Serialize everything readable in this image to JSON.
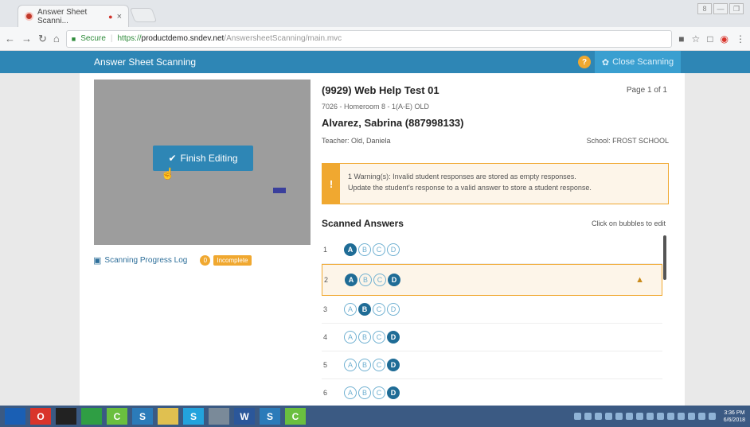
{
  "browser": {
    "tab_title": "Answer Sheet Scanni...",
    "tab_close": "×",
    "secure_label": "Secure",
    "url_scheme": "https://",
    "url_host": "productdemo.sndev.net",
    "url_path": "/AnswersheetScanning/main.mvc",
    "win_buttons": [
      "8",
      "—",
      "❐"
    ],
    "toolbar_icons": [
      "record-icon",
      "star-icon",
      "square-icon",
      "opera-icon",
      "menu-icon"
    ]
  },
  "app": {
    "title": "Answer Sheet Scanning",
    "help_label": "?",
    "close_label": "Close Scanning"
  },
  "scan": {
    "finish_label": "Finish Editing",
    "progress_log_label": "Scanning Progress Log",
    "progress_count": "0",
    "status_badge": "Incomplete"
  },
  "sheet": {
    "test_name": "(9929) Web Help Test 01",
    "page_label": "Page 1 of 1",
    "homeroom": "7026 - Homeroom 8 - 1(A-E) OLD",
    "student": "Alvarez, Sabrina (887998133)",
    "teacher": "Teacher: Old, Daniela",
    "school": "School: FROST SCHOOL"
  },
  "warning": {
    "icon": "!",
    "line1": "1 Warning(s): Invalid student responses are stored as empty responses.",
    "line2": "Update the student's response to a valid answer to store a student response."
  },
  "answers": {
    "title": "Scanned Answers",
    "hint": "Click on bubbles to edit",
    "rows": [
      {
        "num": "1",
        "bubbles": [
          "A",
          "B",
          "C",
          "D"
        ],
        "selected": [
          "A"
        ],
        "warn": false
      },
      {
        "num": "2",
        "bubbles": [
          "A",
          "B",
          "C",
          "D"
        ],
        "selected": [
          "A",
          "D"
        ],
        "warn": true
      },
      {
        "num": "3",
        "bubbles": [
          "A",
          "B",
          "C",
          "D"
        ],
        "selected": [
          "B"
        ],
        "warn": false
      },
      {
        "num": "4",
        "bubbles": [
          "A",
          "B",
          "C",
          "D"
        ],
        "selected": [
          "D"
        ],
        "warn": false
      },
      {
        "num": "5",
        "bubbles": [
          "A",
          "B",
          "C",
          "D"
        ],
        "selected": [
          "D"
        ],
        "warn": false
      },
      {
        "num": "6",
        "bubbles": [
          "A",
          "B",
          "C",
          "D"
        ],
        "selected": [
          "D"
        ],
        "warn": false
      }
    ]
  },
  "taskbar": {
    "apps": [
      {
        "label": "",
        "color": "#1a5fb4"
      },
      {
        "label": "O",
        "color": "#d9342b"
      },
      {
        "label": "",
        "color": "#222222"
      },
      {
        "label": "",
        "color": "#2f9e44"
      },
      {
        "label": "C",
        "color": "#6abf3f"
      },
      {
        "label": "S",
        "color": "#2b7bb9"
      },
      {
        "label": "",
        "color": "#e0c050"
      },
      {
        "label": "S",
        "color": "#23a3dd"
      },
      {
        "label": "",
        "color": "#7a8a99"
      },
      {
        "label": "W",
        "color": "#2b579a"
      },
      {
        "label": "S",
        "color": "#2b7bb9"
      },
      {
        "label": "C",
        "color": "#6abf3f"
      }
    ],
    "time": "3:36 PM",
    "date": "6/6/2018"
  }
}
